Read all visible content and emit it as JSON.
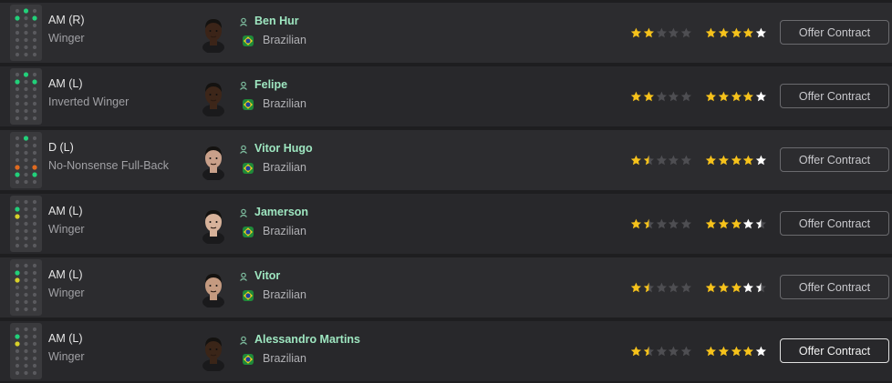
{
  "colors": {
    "name": "#9ee6c0",
    "star_filled": "#f6c21b",
    "star_empty": "#4e4e52",
    "star_potential_white": "#ffffff",
    "pos_green": "#22d07a",
    "pos_yellow": "#d8d02a",
    "pos_orange": "#e06a20"
  },
  "players": [
    {
      "position": "AM (R)",
      "role": "Winger",
      "name": "Ben Hur",
      "nationality": "Brazilian",
      "current_ability_stars": 2,
      "potential_ability_stars": 5,
      "potential_white_from": 4,
      "button": "Offer Contract",
      "skin": "#3b2418"
    },
    {
      "position": "AM (L)",
      "role": "Inverted Winger",
      "name": "Felipe",
      "nationality": "Brazilian",
      "current_ability_stars": 2,
      "potential_ability_stars": 5,
      "potential_white_from": 4,
      "button": "Offer Contract",
      "skin": "#3d2619"
    },
    {
      "position": "D (L)",
      "role": "No-Nonsense Full-Back",
      "name": "Vitor Hugo",
      "nationality": "Brazilian",
      "current_ability_stars": 1.5,
      "potential_ability_stars": 5,
      "potential_white_from": 4,
      "button": "Offer Contract",
      "skin": "#c9a08a"
    },
    {
      "position": "AM (L)",
      "role": "Winger",
      "name": "Jamerson",
      "nationality": "Brazilian",
      "current_ability_stars": 1.5,
      "potential_ability_stars": 4.5,
      "potential_white_from": 3,
      "button": "Offer Contract",
      "skin": "#d7b29a"
    },
    {
      "position": "AM (L)",
      "role": "Winger",
      "name": "Vitor",
      "nationality": "Brazilian",
      "current_ability_stars": 1.5,
      "potential_ability_stars": 4.5,
      "potential_white_from": 3,
      "button": "Offer Contract",
      "skin": "#c49a80"
    },
    {
      "position": "AM (L)",
      "role": "Winger",
      "name": "Alessandro Martins",
      "nationality": "Brazilian",
      "current_ability_stars": 1.5,
      "potential_ability_stars": 5,
      "potential_white_from": 4,
      "button": "Offer Contract",
      "skin": "#3a2518"
    }
  ]
}
